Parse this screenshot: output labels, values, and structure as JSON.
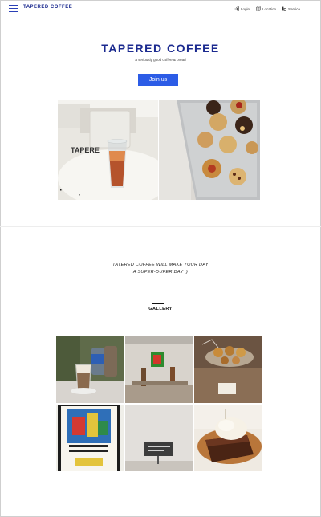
{
  "header": {
    "brand": "TAPERED COFFEE",
    "menu_icon": "hamburger-menu-icon",
    "nav": [
      {
        "label": "Login",
        "icon": "login-icon"
      },
      {
        "label": "Location",
        "icon": "map-icon"
      },
      {
        "label": "Service",
        "icon": "service-icon"
      }
    ]
  },
  "hero": {
    "title": "TAPERED COFFEE",
    "subtitle": "a seriously good coffee & bread",
    "join_label": "Join us"
  },
  "tagline": {
    "line1": "TATERED COFFEE WILL MAKE YOUR DAY",
    "line2": "A SUPER-DUPER DAY :)"
  },
  "gallery": {
    "title": "GALLERY"
  },
  "colors": {
    "brand": "#1b2a8f",
    "accent": "#2c5ce6"
  }
}
